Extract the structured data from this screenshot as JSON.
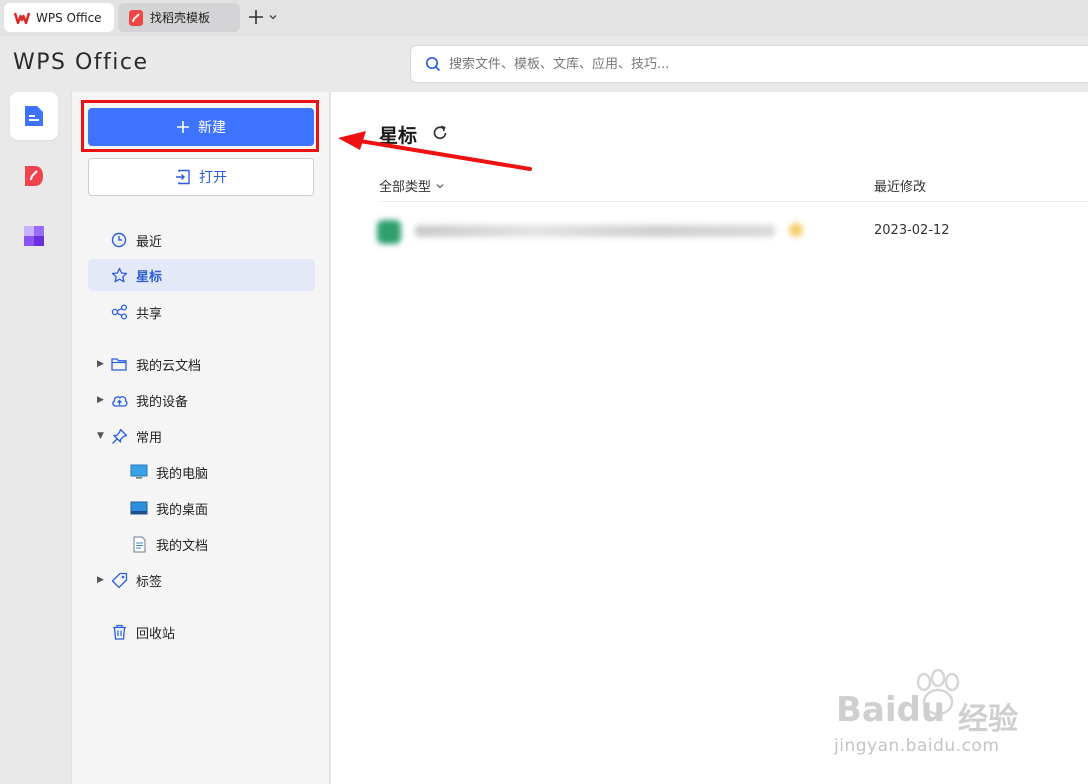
{
  "tabs": [
    {
      "label": "WPS Office",
      "icon": "wps-logo-icon"
    },
    {
      "label": "找稻壳模板",
      "icon": "docer-icon"
    }
  ],
  "header": {
    "logo": "WPS Office",
    "search_placeholder": "搜索文件、模板、文库、应用、技巧..."
  },
  "sidebar": {
    "new_label": "新建",
    "open_label": "打开",
    "items": [
      {
        "label": "最近",
        "icon": "clock-icon"
      },
      {
        "label": "星标",
        "icon": "star-icon"
      },
      {
        "label": "共享",
        "icon": "share-icon"
      },
      {
        "label": "我的云文档",
        "icon": "folder-icon"
      },
      {
        "label": "我的设备",
        "icon": "cloud-upload-icon"
      },
      {
        "label": "常用",
        "icon": "pin-icon"
      },
      {
        "label": "我的电脑",
        "icon": "computer-icon"
      },
      {
        "label": "我的桌面",
        "icon": "desktop-icon"
      },
      {
        "label": "我的文档",
        "icon": "document-icon"
      },
      {
        "label": "标签",
        "icon": "tag-icon"
      },
      {
        "label": "回收站",
        "icon": "trash-icon"
      }
    ]
  },
  "main": {
    "title": "星标",
    "col_type": "全部类型",
    "col_modified": "最近修改",
    "rows": [
      {
        "date": "2023-02-12"
      }
    ]
  },
  "watermark": {
    "brand": "Bai",
    "brand2": "du",
    "cn": "经验",
    "url": "jingyan.baidu.com"
  },
  "colors": {
    "accent": "#3d73ff",
    "highlight": "#ee1111",
    "active_nav_bg": "#e4e9f7"
  }
}
